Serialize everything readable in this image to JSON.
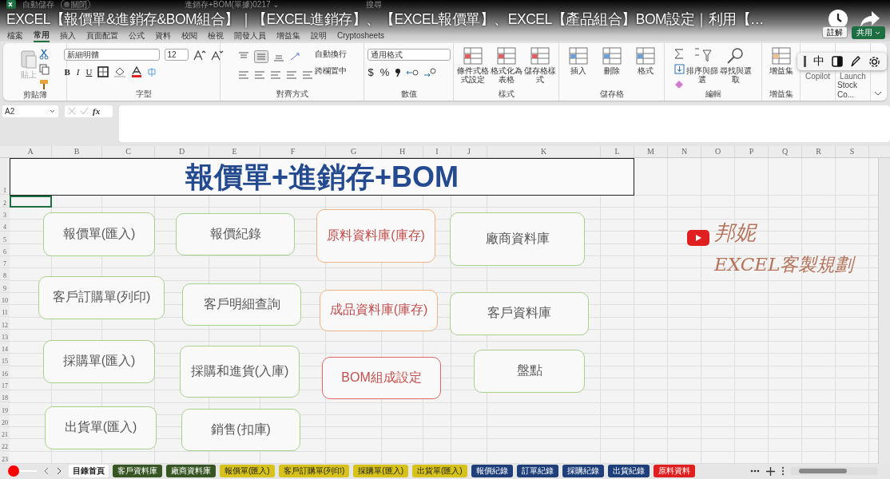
{
  "titlebar": {
    "autosave": "自動儲存",
    "autosave_on": false,
    "autosave_state": "關閉",
    "filename": "進銷存+BOM(單據)0217 ⌄",
    "search": "搜尋"
  },
  "video_title": "EXCEL【報價單&進銷存&BOM組合】｜【EXCEL進銷存】、【EXCEL報價單】、EXCEL【產品組合】BOM設定｜利用【…",
  "menu_tabs": [
    {
      "label": "檔案",
      "selected": false
    },
    {
      "label": "常用",
      "selected": true
    },
    {
      "label": "插入",
      "selected": false
    },
    {
      "label": "頁面配置",
      "selected": false
    },
    {
      "label": "公式",
      "selected": false
    },
    {
      "label": "資料",
      "selected": false
    },
    {
      "label": "校閱",
      "selected": false
    },
    {
      "label": "檢視",
      "selected": false
    },
    {
      "label": "開發人員",
      "selected": false
    },
    {
      "label": "增益集",
      "selected": false
    },
    {
      "label": "說明",
      "selected": false
    },
    {
      "label": "Cryptosheets",
      "selected": false
    }
  ],
  "comment_button": "註解",
  "share_button": "共用",
  "ribbon_groups": [
    {
      "kind": "clipboard",
      "name": "剪貼簿",
      "buttons": [
        "貼上"
      ]
    },
    {
      "kind": "font",
      "name": "字型",
      "font_name": "新細明體",
      "font_size": "12",
      "buttons": [
        "B",
        "I",
        "U"
      ]
    },
    {
      "kind": "alignment",
      "name": "對齊方式",
      "buttons": [
        "自動換行",
        "跨欄置中"
      ]
    },
    {
      "kind": "number",
      "name": "數值",
      "format": "通用格式",
      "buttons": [
        "$",
        "%"
      ]
    },
    {
      "kind": "large",
      "name": "樣式",
      "buttons": [
        "條件式格式設定",
        "格式化為表格",
        "儲存格樣式"
      ]
    },
    {
      "kind": "large",
      "name": "儲存格",
      "buttons": [
        "插入",
        "刪除",
        "格式"
      ]
    },
    {
      "kind": "editing",
      "name": "編輯",
      "buttons": [
        "排序與篩選",
        "尋找與選取"
      ]
    },
    {
      "kind": "large",
      "name": "增益集",
      "buttons": [
        "增益集"
      ]
    },
    {
      "kind": "plain",
      "buttons": [
        "Copilot"
      ]
    },
    {
      "kind": "plain",
      "name": "Stock Co...",
      "buttons": [
        "Launch"
      ]
    }
  ],
  "ime_toolbar": {
    "mode": "中"
  },
  "formula_bar": {
    "name_box": "A2",
    "function_label": "fx"
  },
  "columns": [
    "A",
    "B",
    "C",
    "D",
    "E",
    "F",
    "G",
    "H",
    "I",
    "J",
    "K",
    "L",
    "M",
    "N",
    "O",
    "P",
    "Q",
    "R",
    "S"
  ],
  "rows": [
    "1",
    "2",
    "3",
    "4",
    "5",
    "6",
    "7",
    "8",
    "9",
    "10",
    "11",
    "12",
    "13",
    "14",
    "15",
    "16",
    "17",
    "18",
    "19",
    "20",
    "21",
    "22",
    "23"
  ],
  "sheet_title": "報價單+進銷存+BOM",
  "shapes": [
    {
      "label": "報價單(匯入)",
      "color": "#a9d18e",
      "kind": "plain"
    },
    {
      "label": "報價紀錄",
      "color": "#a9d18e",
      "kind": "plain"
    },
    {
      "label": "原料資料庫(庫存)",
      "color": "#f4b183",
      "kind": "accent"
    },
    {
      "label": "廠商資料庫",
      "color": "#a9d18e",
      "kind": "plain"
    },
    {
      "label": "客戶訂購單(列印)",
      "color": "#a9d18e",
      "kind": "plain"
    },
    {
      "label": "客戶明細查詢",
      "color": "#a9d18e",
      "kind": "plain"
    },
    {
      "label": "成品資料庫(庫存)",
      "color": "#f4b183",
      "kind": "accent"
    },
    {
      "label": "客戶資料庫",
      "color": "#a9d18e",
      "kind": "plain"
    },
    {
      "label": "採購單(匯入)",
      "color": "#a9d18e",
      "kind": "plain"
    },
    {
      "label": "採購和進貨(入庫)",
      "color": "#a9d18e",
      "kind": "plain"
    },
    {
      "label": "BOM組成設定",
      "color": "#e06666",
      "kind": "accent"
    },
    {
      "label": "盤點",
      "color": "#a9d18e",
      "kind": "plain"
    },
    {
      "label": "出貨單(匯入)",
      "color": "#a9d18e",
      "kind": "plain"
    },
    {
      "label": "銷售(扣庫)",
      "color": "#a9d18e",
      "kind": "plain"
    }
  ],
  "brand": {
    "name": "邦妮",
    "tagline": "EXCEL客製規劃"
  },
  "sheet_tabs": [
    {
      "label": "目錄首頁",
      "color": "#ffffff",
      "selected": true
    },
    {
      "label": "客戶資料庫",
      "color": "#375623",
      "selected": false
    },
    {
      "label": "廠商資料庫",
      "color": "#375623",
      "selected": false
    },
    {
      "label": "報價單(匯入)",
      "color": "#d6c21a",
      "selected": false
    },
    {
      "label": "客戶訂購單(列印)",
      "color": "#d6c21a",
      "selected": false
    },
    {
      "label": "採購單(匯入)",
      "color": "#d6c21a",
      "selected": false
    },
    {
      "label": "出貨單(匯入)",
      "color": "#d6c21a",
      "selected": false
    },
    {
      "label": "報價紀錄",
      "color": "#1f3f7a",
      "selected": false
    },
    {
      "label": "訂單紀錄",
      "color": "#1f3f7a",
      "selected": false
    },
    {
      "label": "採購紀錄",
      "color": "#1f3f7a",
      "selected": false
    },
    {
      "label": "出貨紀錄",
      "color": "#1f3f7a",
      "selected": false
    },
    {
      "label": "原料資料",
      "color": "#e02020",
      "selected": false
    }
  ]
}
